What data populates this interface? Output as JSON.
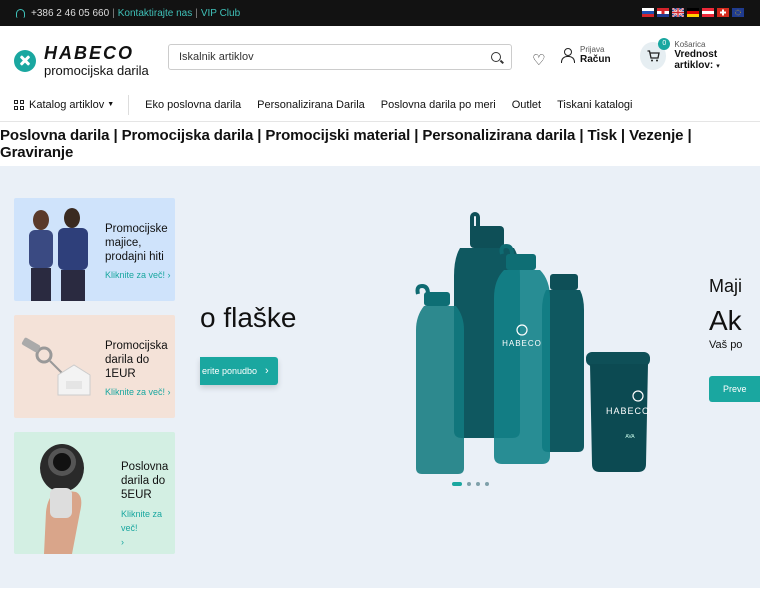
{
  "topbar": {
    "phone": "+386 2 46 05 660",
    "separator": "|",
    "contact_link": "Kontaktirajte nas",
    "vip_link": "VIP Club",
    "flags": [
      "slovenia-flag-icon",
      "croatia-flag-icon",
      "uk-flag-icon",
      "germany-flag-icon",
      "austria-flag-icon",
      "switzerland-flag-icon",
      "eu-flag-icon"
    ]
  },
  "header": {
    "brand": "HABECO",
    "tagline_small": "promocijska darila",
    "search_placeholder": "Iskalnik artiklov",
    "account_small": "Prijava",
    "account_big": "Račun",
    "cart_count": "0",
    "cart_small": "Košarica",
    "cart_big": "Vrednost artiklov:"
  },
  "nav": {
    "catalog": "Katalog artiklov",
    "links": [
      "Eko poslovna darila",
      "Personalizirana Darila",
      "Poslovna darila po meri",
      "Outlet",
      "Tiskani katalogi"
    ]
  },
  "tagline": "Poslovna darila | Promocijska darila | Promocijski material | Personalizirana darila | Tisk | Vezenje | Graviranje",
  "promo_cards": [
    {
      "title": "Promocijske majice, prodajni hiti",
      "more": "Kliknite za več!"
    },
    {
      "title": "Promocijska darila do 1EUR",
      "more": "Kliknite za več!"
    },
    {
      "title": "Poslovna darila do 5EUR",
      "more": "Kliknite za več!"
    }
  ],
  "slide": {
    "title_fragment": "o flaške",
    "button_fragment": "erite ponudbo",
    "bottle_brand": "HABECO",
    "bottle_small": "AVA",
    "active_dot": 0,
    "dot_count": 4
  },
  "next_slide": {
    "line1": "Maji",
    "line2": "Ak",
    "line3": "Vaš po",
    "button": "Preve"
  },
  "colors": {
    "accent": "#1aa7a0",
    "topbar": "#121212",
    "hero_bg": "#eaf0f7",
    "bottle": "#0e4f57"
  }
}
